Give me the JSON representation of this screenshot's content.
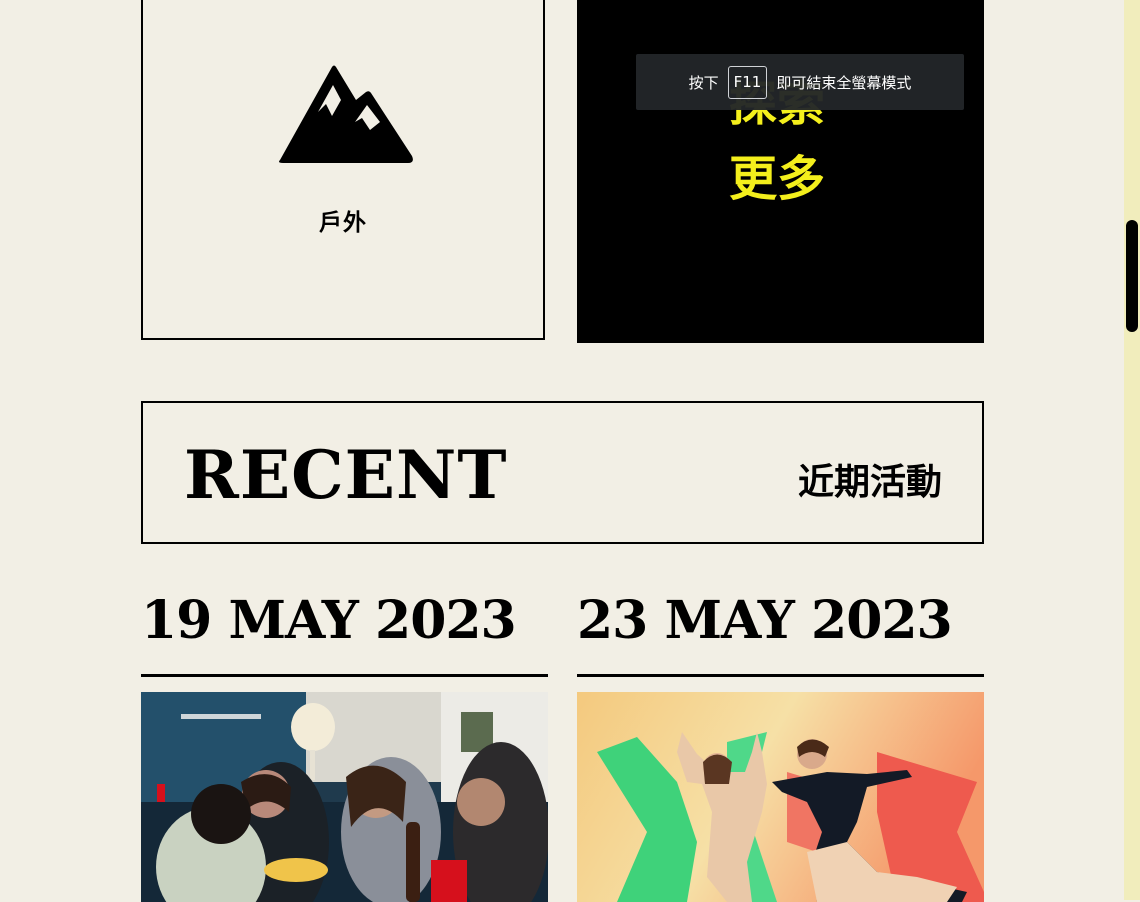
{
  "categories": {
    "outdoor_label": "戶外",
    "explore_line1": "探索",
    "explore_line2": "更多"
  },
  "fullscreen_toast": {
    "before": "按下",
    "key": "F11",
    "after": "即可結束全螢幕模式"
  },
  "recent": {
    "title": "RECENT",
    "subtitle": "近期活動"
  },
  "events": [
    {
      "date": "19 MAY 2023"
    },
    {
      "date": "23 MAY 2023"
    }
  ],
  "colors": {
    "background": "#f2efe5",
    "accent_yellow": "#f4ef1c",
    "scrollbar_track": "#f1edbc"
  }
}
